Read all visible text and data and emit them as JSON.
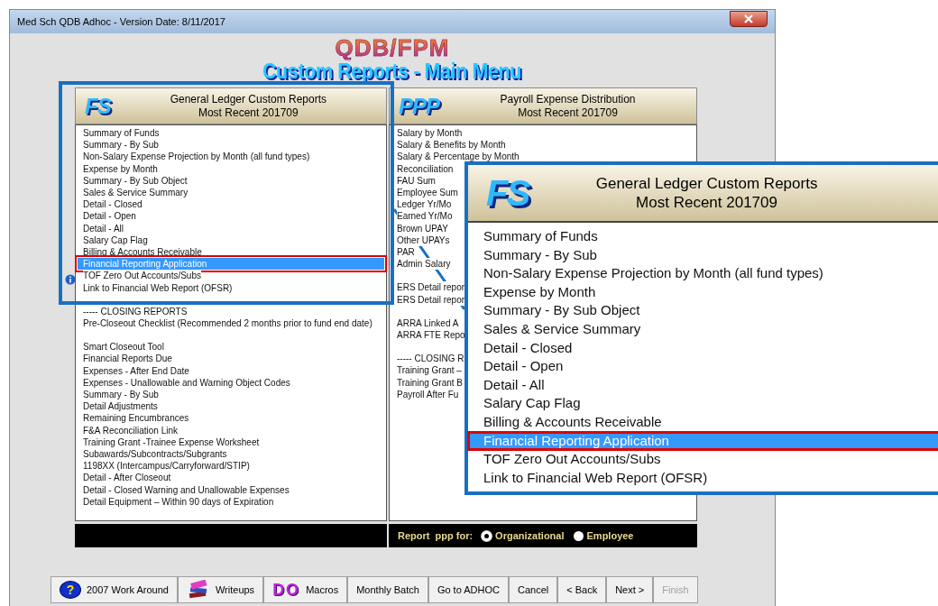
{
  "window": {
    "title": "Med Sch QDB Adhoc - Version Date: 8/11/2017"
  },
  "header": {
    "logo": "QDB/FPM",
    "title": "Custom Reports - Main Menu"
  },
  "panels": [
    {
      "logo": "FS",
      "title": "General Ledger Custom Reports",
      "subtitle": "Most Recent 201709",
      "groups": [
        [
          {
            "label": "Summary of Funds",
            "selected": false
          },
          {
            "label": "Summary - By Sub",
            "selected": false
          },
          {
            "label": "Non-Salary Expense Projection by Month (all fund types)",
            "selected": false
          },
          {
            "label": "Expense by Month",
            "selected": false
          },
          {
            "label": "Summary - By Sub Object",
            "selected": false
          },
          {
            "label": "Sales & Service Summary",
            "selected": false
          },
          {
            "label": "Detail - Closed",
            "selected": false
          },
          {
            "label": "Detail - Open",
            "selected": false
          },
          {
            "label": "Detail - All",
            "selected": false
          },
          {
            "label": "Salary Cap Flag",
            "selected": false
          },
          {
            "label": "Billing & Accounts Receivable",
            "selected": false
          },
          {
            "label": "Financial Reporting Application",
            "selected": true
          },
          {
            "label": "TOF Zero Out Accounts/Subs",
            "selected": false
          },
          {
            "label": "Link to Financial Web Report (OFSR)",
            "selected": false
          }
        ],
        [
          {
            "label": "----- CLOSING REPORTS",
            "selected": false
          },
          {
            "label": "Pre-Closeout Checklist (Recommended 2 months prior to fund end date)",
            "selected": false
          }
        ],
        [
          {
            "label": "Smart Closeout Tool",
            "selected": false
          },
          {
            "label": "Financial Reports Due",
            "selected": false
          },
          {
            "label": "Expenses - After End Date",
            "selected": false
          },
          {
            "label": "Expenses - Unallowable and Warning Object Codes",
            "selected": false
          },
          {
            "label": "Summary - By Sub",
            "selected": false
          },
          {
            "label": "Detail Adjustments",
            "selected": false
          },
          {
            "label": "Remaining Encumbrances",
            "selected": false
          },
          {
            "label": "F&A Reconciliation Link",
            "selected": false
          },
          {
            "label": "Training Grant -Trainee Expense Worksheet",
            "selected": false
          },
          {
            "label": "Subawards/Subcontracts/Subgrants",
            "selected": false
          },
          {
            "label": "1198XX (Intercampus/Carryforward/STIP)",
            "selected": false
          },
          {
            "label": "Detail - After Closeout",
            "selected": false
          },
          {
            "label": "Detail - Closed Warning and Unallowable Expenses",
            "selected": false
          },
          {
            "label": "Detail Equipment – Within 90 days of Expiration",
            "selected": false
          }
        ]
      ]
    },
    {
      "logo": "PPP",
      "title": "Payroll Expense Distribution",
      "subtitle": "Most Recent 201709",
      "groups": [
        [
          {
            "label": "Salary by Month",
            "selected": false
          },
          {
            "label": "Salary & Benefits by Month",
            "selected": false
          },
          {
            "label": "Salary & Percentage by Month",
            "selected": false
          },
          {
            "label": "Reconciliation",
            "selected": false
          },
          {
            "label": "FAU Sum",
            "selected": false
          },
          {
            "label": "Employee Sum",
            "selected": false
          },
          {
            "label": "Ledger Yr/Mo",
            "selected": false
          },
          {
            "label": "Earned Yr/Mo",
            "selected": false
          },
          {
            "label": "Brown UPAY",
            "selected": false
          },
          {
            "label": "Other UPAYs",
            "selected": false
          },
          {
            "label": "PAR",
            "selected": false
          },
          {
            "label": "Admin Salary",
            "selected": false
          }
        ],
        [
          {
            "label": "ERS Detail repor",
            "selected": false
          },
          {
            "label": "ERS Detail repor",
            "selected": false
          }
        ],
        [
          {
            "label": "ARRA Linked A",
            "selected": false
          },
          {
            "label": "ARRA FTE Repo",
            "selected": false
          }
        ],
        [
          {
            "label": "----- CLOSING R",
            "selected": false
          },
          {
            "label": "Training Grant –",
            "selected": false
          },
          {
            "label": "Training Grant B",
            "selected": false
          },
          {
            "label": "Payroll After Fu",
            "selected": false
          }
        ]
      ],
      "footer": {
        "label": "Report  ppp for:",
        "options": [
          {
            "label": "Organizational",
            "selected": true
          },
          {
            "label": "Employee",
            "selected": false
          }
        ]
      }
    }
  ],
  "callout": {
    "logo": "FS",
    "title": "General Ledger Custom Reports",
    "subtitle": "Most Recent 201709",
    "items": [
      {
        "label": "Summary of Funds",
        "selected": false
      },
      {
        "label": "Summary - By Sub",
        "selected": false
      },
      {
        "label": "Non-Salary Expense Projection by Month (all fund types)",
        "selected": false
      },
      {
        "label": "Expense by Month",
        "selected": false
      },
      {
        "label": "Summary - By Sub Object",
        "selected": false
      },
      {
        "label": "Sales & Service Summary",
        "selected": false
      },
      {
        "label": "Detail - Closed",
        "selected": false
      },
      {
        "label": "Detail - Open",
        "selected": false
      },
      {
        "label": "Detail - All",
        "selected": false
      },
      {
        "label": "Salary Cap Flag",
        "selected": false
      },
      {
        "label": "Billing & Accounts Receivable",
        "selected": false
      },
      {
        "label": "Financial Reporting Application",
        "selected": true
      },
      {
        "label": "TOF Zero Out Accounts/Subs",
        "selected": false
      },
      {
        "label": "Link to Financial Web Report (OFSR)",
        "selected": false
      }
    ]
  },
  "buttons": [
    {
      "label": "2007 Work Around",
      "kind": "help",
      "glyph": "?",
      "disabled": false
    },
    {
      "label": "Writeups",
      "kind": "books",
      "disabled": false
    },
    {
      "label": "Macros",
      "kind": "do",
      "badge": "DO",
      "disabled": false
    },
    {
      "label": "Monthly Batch",
      "kind": "plain",
      "disabled": false
    },
    {
      "label": "Go to ADHOC",
      "kind": "plain",
      "disabled": false
    },
    {
      "label": "Cancel",
      "kind": "plain",
      "disabled": false
    },
    {
      "label": "< Back",
      "kind": "plain",
      "disabled": false
    },
    {
      "label": "Next >",
      "kind": "plain",
      "disabled": false
    },
    {
      "label": "Finish",
      "kind": "plain",
      "disabled": true
    }
  ]
}
